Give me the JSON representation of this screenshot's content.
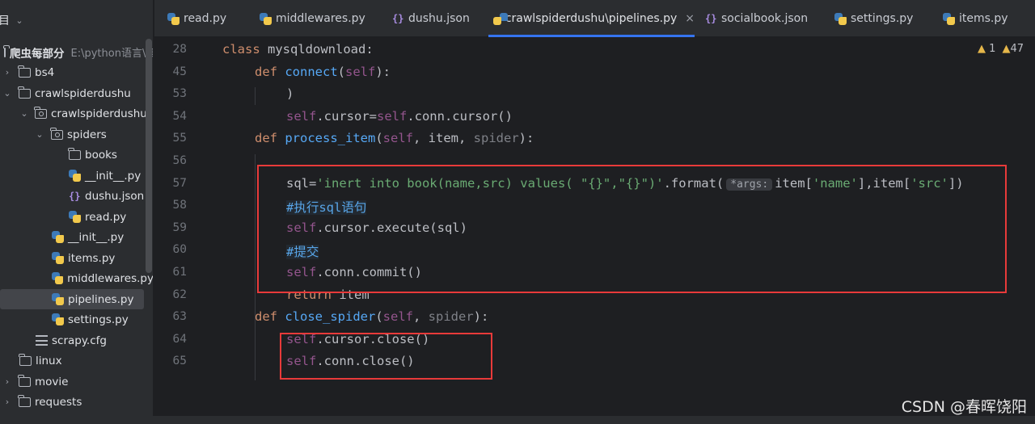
{
  "sidebar": {
    "header": "目",
    "root": {
      "name": "爬虫每部分",
      "path": "E:\\python语言\\爬"
    },
    "items": [
      {
        "label": "bs4"
      },
      {
        "label": "crawlspiderdushu"
      },
      {
        "label": "crawlspiderdushu"
      },
      {
        "label": "spiders"
      },
      {
        "label": "books"
      },
      {
        "label": "__init__.py"
      },
      {
        "label": "dushu.json"
      },
      {
        "label": "read.py"
      },
      {
        "label": "__init__.py"
      },
      {
        "label": "items.py"
      },
      {
        "label": "middlewares.py"
      },
      {
        "label": "pipelines.py"
      },
      {
        "label": "settings.py"
      },
      {
        "label": "scrapy.cfg"
      },
      {
        "label": "linux"
      },
      {
        "label": "movie"
      },
      {
        "label": "requests"
      }
    ]
  },
  "tabs": [
    {
      "label": "read.py",
      "icon": "python-file-icon"
    },
    {
      "label": "middlewares.py",
      "icon": "python-file-icon"
    },
    {
      "label": "dushu.json",
      "icon": "json-file-icon"
    },
    {
      "label": "crawlspiderdushu\\pipelines.py",
      "icon": "python-file-icon",
      "active": true
    },
    {
      "label": "socialbook.json",
      "icon": "json-file-icon"
    },
    {
      "label": "settings.py",
      "icon": "python-file-icon"
    },
    {
      "label": "items.py",
      "icon": "python-file-icon"
    }
  ],
  "inspections": {
    "warnings": "1",
    "weak_warnings": "47"
  },
  "lines": [
    {
      "num": "28"
    },
    {
      "num": "45"
    },
    {
      "num": "53"
    },
    {
      "num": "54"
    },
    {
      "num": "55"
    },
    {
      "num": "56"
    },
    {
      "num": "57"
    },
    {
      "num": "58"
    },
    {
      "num": "59"
    },
    {
      "num": "60"
    },
    {
      "num": "61"
    },
    {
      "num": "62"
    },
    {
      "num": "63"
    },
    {
      "num": "64"
    },
    {
      "num": "65"
    }
  ],
  "code": {
    "l28": {
      "kw": "class",
      "name": "mysqldownload:"
    },
    "l45": {
      "kw": "def",
      "fn": "connect",
      "open": "(",
      "self": "self",
      "close": "):"
    },
    "l53": {
      "text": ")"
    },
    "l54": {
      "self1": "self",
      "mid": ".cursor=",
      "self2": "self",
      "rest": ".conn.cursor()"
    },
    "l55": {
      "kw": "def",
      "fn": "process_item",
      "open": "(",
      "self": "self",
      "mid": ", item, ",
      "param": "spider",
      "close": "):"
    },
    "l57": {
      "a": "sql=",
      "str1": "'inert into book(name,src) values( \"{}\",\"{}\")'",
      "b": ".format(",
      "hint": "*args:",
      "c": "item[",
      "str2": "'name'",
      "d": "],item[",
      "str3": "'src'",
      "e": "])"
    },
    "l58": {
      "cmt": "#执行sql语句"
    },
    "l59": {
      "self": "self",
      "rest": ".cursor.execute(sql)"
    },
    "l60": {
      "cmt": "#提交"
    },
    "l61": {
      "self": "self",
      "rest": ".conn.commit()"
    },
    "l62": {
      "kw": "return",
      "rest": " item"
    },
    "l63": {
      "kw": "def",
      "fn": "close_spider",
      "open": "(",
      "self": "self",
      "mid": ", ",
      "param": "spider",
      "close": "):"
    },
    "l64": {
      "self": "self",
      "rest": ".cursor.close()"
    },
    "l65": {
      "self": "self",
      "rest": ".conn.close()"
    }
  },
  "watermark": "CSDN @春晖饶阳"
}
